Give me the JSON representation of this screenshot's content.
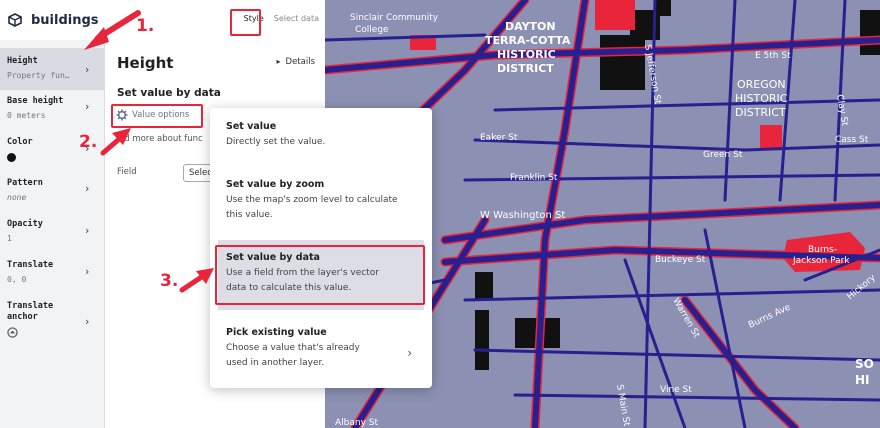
{
  "app": {
    "layer_title": "buildings"
  },
  "properties": [
    {
      "name": "Height",
      "value": "Property fun…",
      "active": true
    },
    {
      "name": "Base height",
      "value": "0 meters"
    },
    {
      "name": "Color",
      "value": ""
    },
    {
      "name": "Pattern",
      "value": "none"
    },
    {
      "name": "Opacity",
      "value": "1"
    },
    {
      "name": "Translate",
      "value": "0, 0"
    },
    {
      "name": "Translate anchor",
      "value": ""
    }
  ],
  "tabs": {
    "style": "Style",
    "select_data": "Select data"
  },
  "panel": {
    "title": "Height",
    "details": "Details",
    "section_title": "Set value by data",
    "value_options": "Value options",
    "read_more": "ad more about func",
    "field_label": "Field",
    "field_select": "Selec"
  },
  "menu": {
    "items": [
      {
        "title": "Set value",
        "desc1": "Directly set the value.",
        "desc2": ""
      },
      {
        "title": "Set value by zoom",
        "desc1": "Use the map's zoom level to calculate",
        "desc2": "this value."
      },
      {
        "title": "Set value by data",
        "desc1": "Use a field from the layer's vector",
        "desc2": "data to calculate this value."
      },
      {
        "title": "Pick existing value",
        "desc1": "Choose a value that's already",
        "desc2": "used in another layer."
      }
    ]
  },
  "annotations": {
    "step1": "1.",
    "step2": "2.",
    "step3": "3."
  },
  "map_labels": {
    "sinclair1": "Sinclair Community",
    "sinclair2": "College",
    "dayton1": "DAYTON",
    "dayton2": "TERRA-COTTA",
    "dayton3": "HISTORIC",
    "dayton4": "DISTRICT",
    "oregon1": "OREGON",
    "oregon2": "HISTORIC",
    "oregon3": "DISTRICT",
    "e5th": "E 5th St",
    "sjefferson": "S Jefferson St",
    "eaker": "Eaker St",
    "green": "Green St",
    "cass": "Cass St",
    "franklin": "Franklin St",
    "wwashington": "W Washington St",
    "buckeye": "Buckeye St",
    "burns1": "Burns-",
    "burns2": "Jackson Park",
    "warren": "Warren St",
    "burns_ave": "Burns Ave",
    "vine": "Vine St",
    "smain": "S Main St",
    "albany": "Albany St",
    "hickory": "Hickory",
    "clay": "Clay St",
    "so": "SO",
    "hi": "HI"
  },
  "colors": {
    "accent_red": "#e8253a",
    "map_bg": "#8c90b3",
    "road": "#2a1f8f",
    "road_edge": "#e8253a",
    "building": "#111111",
    "highlight_building": "#e8253a"
  }
}
